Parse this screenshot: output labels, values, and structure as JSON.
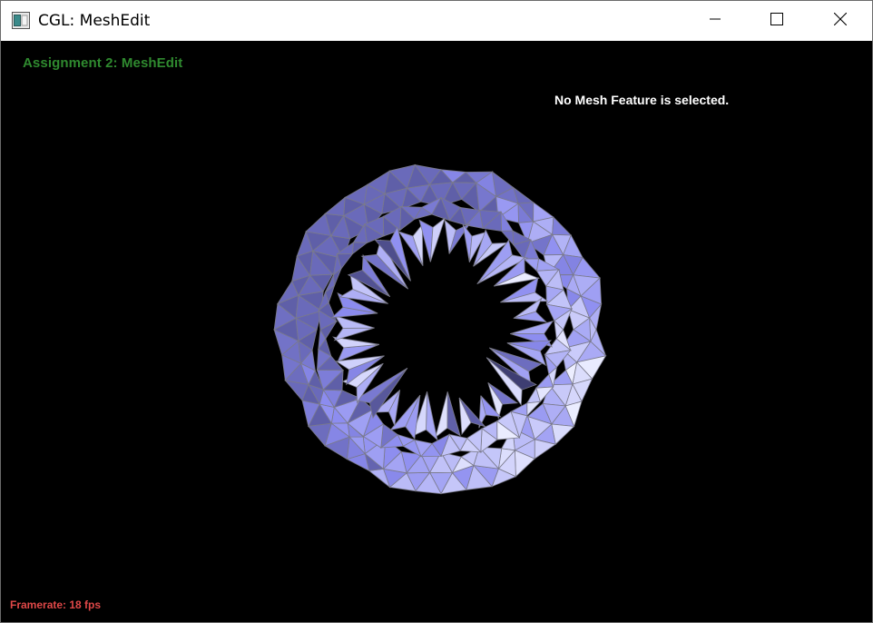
{
  "window": {
    "title": "CGL: MeshEdit",
    "icon": "application-window-icon",
    "controls": [
      "minimize-icon",
      "maximize-icon",
      "close-icon"
    ]
  },
  "hud": {
    "assignment_title": "Assignment 2: MeshEdit",
    "status_text": "No Mesh Feature is selected.",
    "framerate_text": "Framerate: 18 fps"
  },
  "colors": {
    "title_bar": "#ffffff",
    "viewport": "#000000",
    "assignment_title": "#2f8a2f",
    "status_text": "#ffffff",
    "framerate_text": "#e04848",
    "mesh_face_light": "#eceeff",
    "mesh_face_mid": "#8c8cf0",
    "mesh_face_dark": "#1c1c3c",
    "mesh_edge": "#7a7a8a"
  }
}
